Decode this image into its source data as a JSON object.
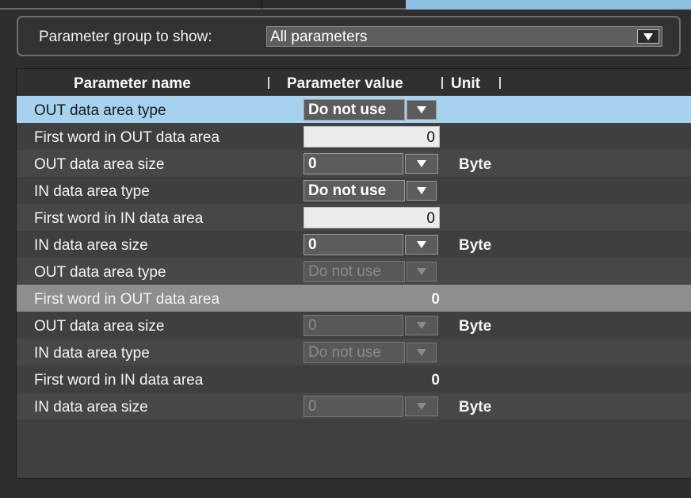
{
  "filter": {
    "label": "Parameter group to show:",
    "selected": "All parameters"
  },
  "columns": {
    "name": "Parameter name",
    "value": "Parameter value",
    "unit": "Unit"
  },
  "rows": [
    {
      "name": "OUT data area type",
      "value": "Do not use",
      "unit": ""
    },
    {
      "name": "First word in OUT data area",
      "value": "0",
      "unit": ""
    },
    {
      "name": "OUT data area size",
      "value": "0",
      "unit": "Byte"
    },
    {
      "name": "IN data area type",
      "value": "Do not use",
      "unit": ""
    },
    {
      "name": "First word in IN data area",
      "value": "0",
      "unit": ""
    },
    {
      "name": "IN data area size",
      "value": "0",
      "unit": "Byte"
    },
    {
      "name": "OUT data area type",
      "value": "Do not use",
      "unit": ""
    },
    {
      "name": "First word in OUT data area",
      "value": "0",
      "unit": ""
    },
    {
      "name": "OUT data area size",
      "value": "0",
      "unit": "Byte"
    },
    {
      "name": "IN data area type",
      "value": "Do not use",
      "unit": ""
    },
    {
      "name": "First word in IN data area",
      "value": "0",
      "unit": ""
    },
    {
      "name": "IN data area size",
      "value": "0",
      "unit": "Byte"
    }
  ],
  "colors": {
    "selected_row": "#a7d2ef",
    "highlight_row": "#8e8e8e",
    "background": "#404040"
  },
  "icons": {
    "dropdown_arrow": "triangle-down-icon"
  }
}
